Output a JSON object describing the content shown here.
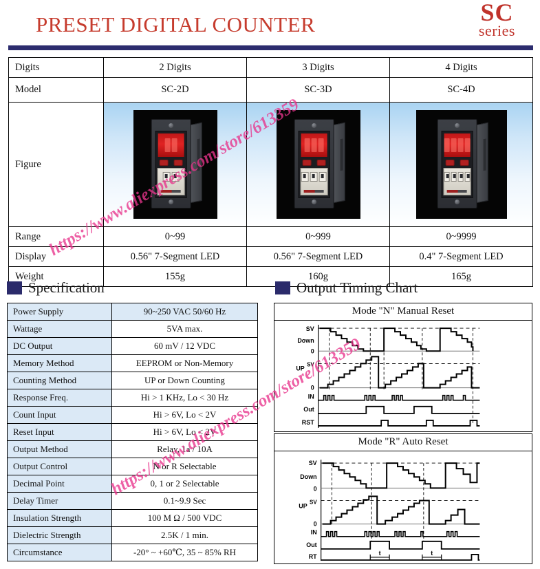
{
  "header": {
    "title": "PRESET DIGITAL COUNTER",
    "series_code": "SC",
    "series_word": "series",
    "title_color": "#c63c2e",
    "rule_color": "#2c2c6e"
  },
  "models_table": {
    "rows": [
      {
        "label": "Digits",
        "values": [
          "2 Digits",
          "3 Digits",
          "4 Digits"
        ]
      },
      {
        "label": "Model",
        "values": [
          "SC-2D",
          "SC-3D",
          "SC-4D"
        ]
      },
      {
        "label": "Figure",
        "values": [
          "",
          "",
          ""
        ]
      },
      {
        "label": "Range",
        "values": [
          "0~99",
          "0~999",
          "0~9999"
        ]
      },
      {
        "label": "Display",
        "values": [
          "0.56\" 7-Segment LED",
          "0.56\" 7-Segment LED",
          "0.4\" 7-Segment LED"
        ]
      },
      {
        "label": "Weight",
        "values": [
          "155g",
          "160g",
          "165g"
        ]
      }
    ],
    "figure_digits": [
      2,
      3,
      4
    ],
    "figure_bg_top": "#aad4f2"
  },
  "specification": {
    "heading": "Specification",
    "marker_color": "#2b2b6b",
    "rows": [
      {
        "key": "Power Supply",
        "value": "90~250 VAC 50/60 Hz"
      },
      {
        "key": "Wattage",
        "value": "5VA max."
      },
      {
        "key": "DC Output",
        "value": "60 mV / 12 VDC"
      },
      {
        "key": "Memory Method",
        "value": "EEPROM or Non-Memory"
      },
      {
        "key": "Counting Method",
        "value": "UP or Down Counting"
      },
      {
        "key": "Response Freq.",
        "value": "Hi > 1 KHz, Lo < 30 Hz"
      },
      {
        "key": "Count Input",
        "value": "Hi > 6V, Lo < 2V"
      },
      {
        "key": "Reset Input",
        "value": "Hi > 6V, Lo < 2V"
      },
      {
        "key": "Output Method",
        "value": "Relay, 1a / 10A"
      },
      {
        "key": "Output Control",
        "value": "N or R Selectable"
      },
      {
        "key": "Decimal Point",
        "value": "0, 1 or 2 Selectable"
      },
      {
        "key": "Delay Timer",
        "value": "0.1~9.9 Sec"
      },
      {
        "key": "Insulation Strength",
        "value": "100 M Ω / 500 VDC"
      },
      {
        "key": "Dielectric Strength",
        "value": "2.5K / 1 min."
      },
      {
        "key": "Circumstance",
        "value": "-20° ~ +60℃, 35 ~ 85% RH"
      }
    ]
  },
  "timing": {
    "heading": "Output Timing Chart",
    "charts": [
      {
        "title": "Mode \"N\" Manual Reset",
        "labels": {
          "sv_top": "SV",
          "down": "Down",
          "zero_top": "0",
          "up": "UP",
          "sv_mid": "SV",
          "zero_mid": "0",
          "in": "IN",
          "out": "Out",
          "reset": "RST"
        },
        "duration_marks": []
      },
      {
        "title": "Mode \"R\" Auto Reset",
        "labels": {
          "sv_top": "SV",
          "down": "Down",
          "zero_top": "0",
          "up": "UP",
          "sv_mid": "SV",
          "zero_mid": "0",
          "in": "IN",
          "out": "Out",
          "reset": "RT"
        },
        "duration_marks": [
          "t",
          "t"
        ]
      }
    ]
  },
  "watermarks": {
    "text": "https://www.aliexpress.com/store/613359",
    "color": "#e8348c"
  }
}
